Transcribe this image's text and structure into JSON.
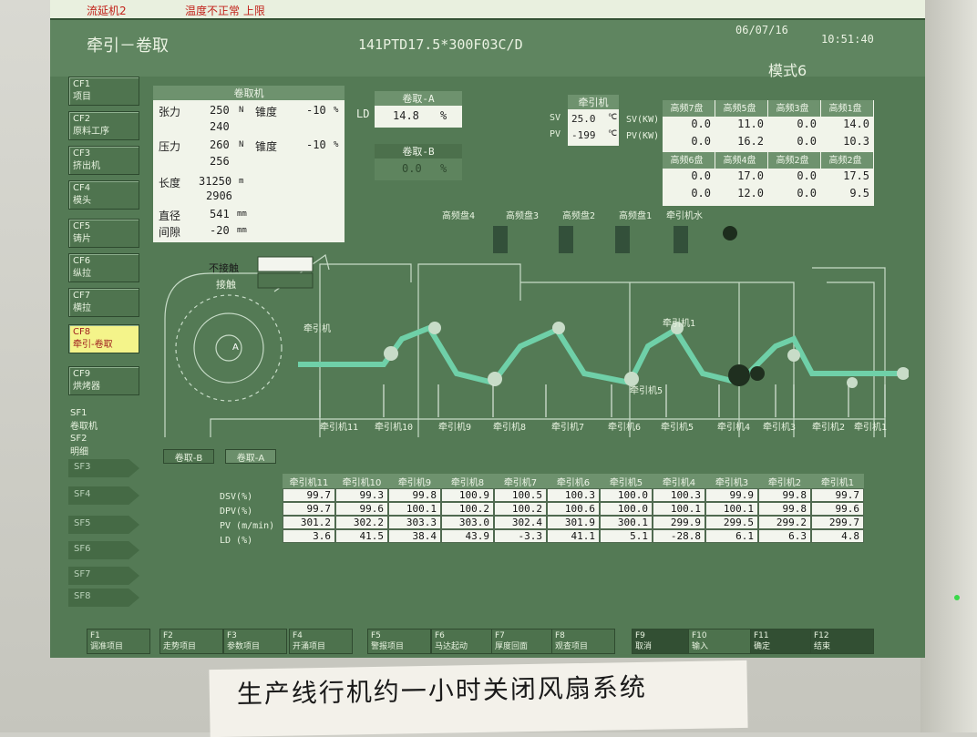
{
  "topbar": {
    "left": "流延机2",
    "alarm": "温度不正常  上限",
    "date": "06/07/16",
    "time": "10:51:40"
  },
  "header": {
    "title": "牵引－卷取",
    "product": "141PTD17.5*300F03C/D",
    "mode": "模式6"
  },
  "sidebar": {
    "items": [
      {
        "code": "CF1",
        "label": "项目"
      },
      {
        "code": "CF2",
        "label": "原料工序"
      },
      {
        "code": "CF3",
        "label": "挤出机"
      },
      {
        "code": "CF4",
        "label": "模头"
      },
      {
        "code": "CF5",
        "label": "铸片"
      },
      {
        "code": "CF6",
        "label": "纵拉"
      },
      {
        "code": "CF7",
        "label": "横拉"
      },
      {
        "code": "CF8",
        "label": "牵引-卷取"
      },
      {
        "code": "CF9",
        "label": "烘烤器"
      }
    ],
    "sf_items": [
      {
        "code": "SF1",
        "label": "卷取机"
      },
      {
        "code": "SF2",
        "label": "明细"
      },
      {
        "code": "SF3",
        "label": ""
      },
      {
        "code": "SF4",
        "label": ""
      },
      {
        "code": "SF5",
        "label": ""
      },
      {
        "code": "SF6",
        "label": ""
      },
      {
        "code": "SF7",
        "label": ""
      },
      {
        "code": "SF8",
        "label": ""
      }
    ]
  },
  "winder": {
    "title": "卷取机",
    "tension_label": "张力",
    "tension_sv": "250",
    "tension_pv": "240",
    "tension_unit": "N",
    "taper1_label": "锥度",
    "taper1": "-10",
    "pressure_label": "压力",
    "pressure_sv": "260",
    "pressure_pv": "256",
    "pressure_unit": "N",
    "taper2_label": "锥度",
    "taper2": "-10",
    "pct": "%",
    "length_label": "长度",
    "length_sv": "31250",
    "length_pv": "2906",
    "length_unit": "m",
    "diameter_label": "直径",
    "diameter": "541",
    "diameter_unit": "mm",
    "gap_label": "间隙",
    "gap": "-20",
    "gap_unit": "mm"
  },
  "rollA": {
    "title": "卷取-A",
    "ld_label": "LD",
    "value": "14.8",
    "unit": "%"
  },
  "rollB": {
    "title": "卷取-B",
    "value": "0.0",
    "unit": "%"
  },
  "puller": {
    "title": "牵引机",
    "sv_label": "SV",
    "pv_label": "PV",
    "sv": "25.0",
    "pv": "-199",
    "unit": "℃",
    "sv_kw": "SV(KW)",
    "pv_kw": "PV(KW)"
  },
  "hf": {
    "headers_top": [
      "高频7盘",
      "高频5盘",
      "高频3盘",
      "高频1盘"
    ],
    "row1": [
      "0.0",
      "11.0",
      "0.0",
      "14.0"
    ],
    "row2": [
      "0.0",
      "16.2",
      "0.0",
      "10.3"
    ],
    "headers_bottom": [
      "高频6盘",
      "高频4盘",
      "高频2盘",
      "高频2盘"
    ],
    "row3": [
      "0.0",
      "17.0",
      "0.0",
      "17.5"
    ],
    "row4": [
      "0.0",
      "12.0",
      "0.0",
      "9.5"
    ]
  },
  "diagram": {
    "labels_top": [
      "高频盘4",
      "高频盘3",
      "高频盘2",
      "高频盘1",
      "牵引机水"
    ],
    "contact": "不接触",
    "contact2": "接触",
    "rollA": "A",
    "puller_top": "牵引机",
    "puller_mid": "牵引机1",
    "labels_bottom": [
      "牵引机11",
      "牵引机10",
      "牵引机9",
      "牵引机8",
      "牵引机7",
      "牵引机6",
      "牵引机5",
      "牵引机4",
      "牵引机3",
      "牵引机2",
      "牵引机1"
    ],
    "puller_bottom_mid": "牵引机5"
  },
  "tabs": {
    "b": "卷取-B",
    "a": "卷取-A"
  },
  "table": {
    "row_labels": [
      "DSV(%)",
      "DPV(%)",
      "PV (m/min)",
      "LD (%)"
    ],
    "columns": [
      "牵引机11",
      "牵引机10",
      "牵引机9",
      "牵引机8",
      "牵引机7",
      "牵引机6",
      "牵引机5",
      "牵引机4",
      "牵引机3",
      "牵引机2",
      "牵引机1"
    ],
    "dsv": [
      "99.7",
      "99.3",
      "99.8",
      "100.9",
      "100.5",
      "100.3",
      "100.0",
      "100.3",
      "99.9",
      "99.8",
      "99.7"
    ],
    "dpv": [
      "99.7",
      "99.6",
      "100.1",
      "100.2",
      "100.2",
      "100.6",
      "100.0",
      "100.1",
      "100.1",
      "99.8",
      "99.6"
    ],
    "pv": [
      "301.2",
      "302.2",
      "303.3",
      "303.0",
      "302.4",
      "301.9",
      "300.1",
      "299.9",
      "299.5",
      "299.2",
      "299.7"
    ],
    "ld": [
      "3.6",
      "41.5",
      "38.4",
      "43.9",
      "-3.3",
      "41.1",
      "5.1",
      "-28.8",
      "6.1",
      "6.3",
      "4.8"
    ]
  },
  "fkeys": [
    {
      "k": "F1",
      "l": "调准项目"
    },
    {
      "k": "F2",
      "l": "走势项目"
    },
    {
      "k": "F3",
      "l": "参数项目"
    },
    {
      "k": "F4",
      "l": "开涌项目"
    },
    {
      "k": "F5",
      "l": "警报项目"
    },
    {
      "k": "F6",
      "l": "马达起动"
    },
    {
      "k": "F7",
      "l": "厚度回面"
    },
    {
      "k": "F8",
      "l": "观查项目"
    },
    {
      "k": "F9",
      "l": "取消"
    },
    {
      "k": "F10",
      "l": "输入"
    },
    {
      "k": "F11",
      "l": "确定"
    },
    {
      "k": "F12",
      "l": "结束"
    }
  ],
  "note": "生产线行机约一小时关闭风扇系统"
}
